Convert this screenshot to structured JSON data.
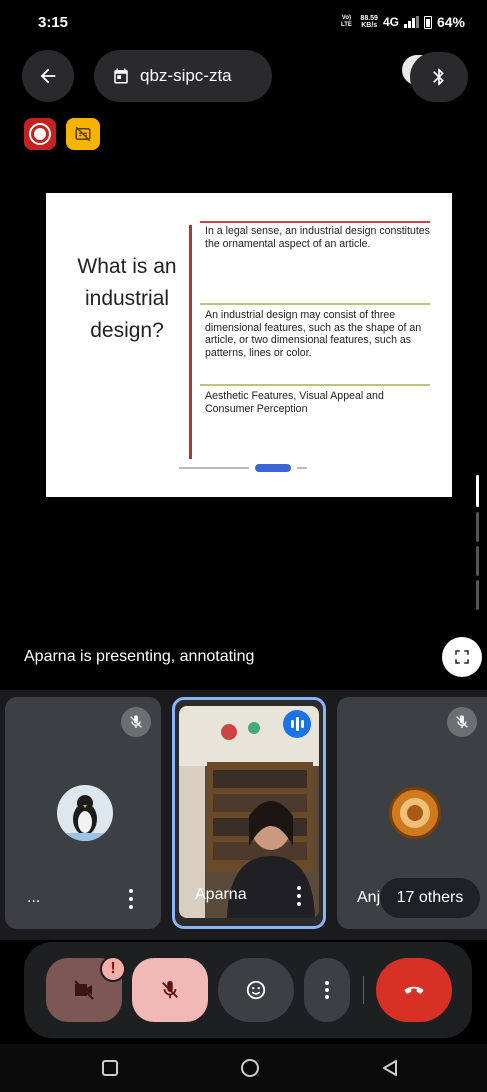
{
  "status_bar": {
    "time": "3:15",
    "volte": "Vo) LTE",
    "speed_value": "88.59",
    "speed_unit": "KB/s",
    "network": "4G",
    "battery": "64%"
  },
  "top_bar": {
    "back_icon": "arrow-left-icon",
    "meeting_code": "qbz-sipc-zta",
    "meeting_icon": "calendar-icon",
    "bluetooth_icon": "bluetooth-icon"
  },
  "indicators": {
    "recording_icon": "record-icon",
    "captions_icon": "captions-off-icon"
  },
  "slide": {
    "title": "What is an industrial design?",
    "points": [
      "In a legal sense, an industrial design constitutes the ornamental aspect of an article.",
      "An industrial design may consist of three dimensional features, such as the shape of an article, or two dimensional features, such as patterns, lines or color.",
      "Aesthetic Features, Visual Appeal and Consumer Perception"
    ],
    "divider_colors": [
      "#c9444b",
      "#b9c57a",
      "#b9c57a",
      "#c9a24b"
    ]
  },
  "presenting_text": "Aparna is presenting, annotating",
  "fullscreen_icon": "fullscreen-icon",
  "participants": [
    {
      "name": "...",
      "muted": true,
      "avatar": "penguin-avatar"
    },
    {
      "name": "Aparna",
      "speaking": true,
      "video": true
    },
    {
      "name": "Anj",
      "muted": true,
      "avatar": "seal-avatar"
    }
  ],
  "others_label": "17 others",
  "controls": {
    "camera": "camera-off-icon",
    "camera_alert": "!",
    "mic": "mic-off-icon",
    "reactions": "emoji-icon",
    "more": "more-vert-icon",
    "leave": "call-end-icon"
  },
  "colors": {
    "accent_blue": "#1a73e8",
    "leave_red": "#d93025",
    "recording_red": "#c5221f",
    "captions_yellow": "#f5b400"
  }
}
